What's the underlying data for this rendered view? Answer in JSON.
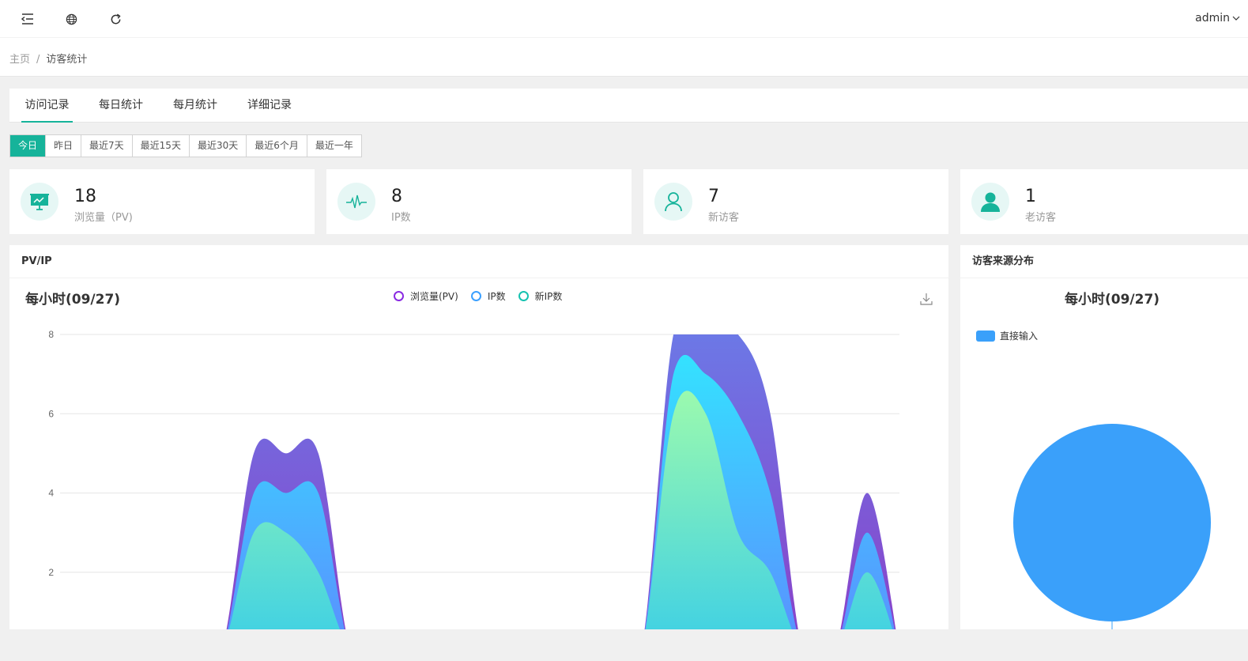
{
  "header": {
    "user": "admin"
  },
  "breadcrumb": {
    "home": "主页",
    "separator": "/",
    "current": "访客统计"
  },
  "tabs": [
    "访问记录",
    "每日统计",
    "每月统计",
    "详细记录"
  ],
  "ranges": [
    "今日",
    "昨日",
    "最近7天",
    "最近15天",
    "最近30天",
    "最近6个月",
    "最近一年"
  ],
  "stats": [
    {
      "value": "18",
      "label": "浏览量（PV)",
      "icon": "presentation-icon"
    },
    {
      "value": "8",
      "label": "IP数",
      "icon": "pulse-icon"
    },
    {
      "value": "7",
      "label": "新访客",
      "icon": "user-outline-icon"
    },
    {
      "value": "1",
      "label": "老访客",
      "icon": "user-solid-icon"
    }
  ],
  "pv_panel": {
    "heading": "PV/IP"
  },
  "source_panel": {
    "heading": "访客来源分布"
  },
  "colors": {
    "accent": "#16b39a",
    "pv": "#8a2be2",
    "ip": "#3ba0ff",
    "newip": "#16c2b0",
    "pie": "#3aa0fa"
  },
  "chart_data": [
    {
      "type": "area",
      "title": "每小时(09/27)",
      "series": [
        {
          "name": "浏览量(PV)",
          "values": [
            0,
            0,
            0,
            0,
            0,
            0,
            5,
            5,
            5,
            0,
            0,
            0,
            0,
            0,
            0,
            0,
            0,
            0,
            0,
            8,
            8,
            8,
            6,
            0,
            0,
            4,
            0
          ]
        },
        {
          "name": "IP数",
          "values": [
            0,
            0,
            0,
            0,
            0,
            0,
            4,
            4,
            4,
            0,
            0,
            0,
            0,
            0,
            0,
            0,
            0,
            0,
            0,
            7,
            7,
            6,
            4,
            0,
            0,
            3,
            0
          ]
        },
        {
          "name": "新IP数",
          "values": [
            0,
            0,
            0,
            0,
            0,
            0,
            3,
            3,
            2,
            0,
            0,
            0,
            0,
            0,
            0,
            0,
            0,
            0,
            0,
            6,
            6,
            3,
            2,
            0,
            0,
            2,
            0
          ]
        }
      ],
      "yticks": [
        "2",
        "4",
        "6",
        "8"
      ],
      "ylim": [
        0,
        8
      ],
      "grid": true,
      "legend": "top-center"
    },
    {
      "type": "pie",
      "title": "每小时(09/27)",
      "categories": [
        "直接输入"
      ],
      "values": [
        18
      ],
      "legend": "top-left"
    }
  ]
}
